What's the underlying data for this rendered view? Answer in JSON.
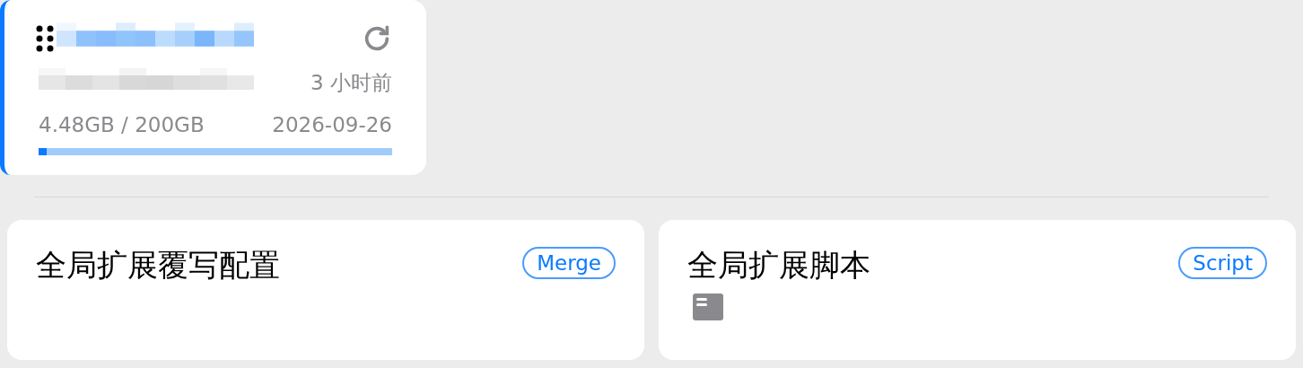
{
  "profile_card": {
    "selected": true,
    "updated": "3 小时前",
    "usage": "4.48GB / 200GB",
    "expires": "2026-09-26",
    "level": 0.0224
  },
  "extension_cards": [
    {
      "title": "全局扩展覆写配置",
      "tag": "Merge",
      "kind": "merge"
    },
    {
      "title": "全局扩展脚本",
      "tag": "Script",
      "kind": "script"
    }
  ]
}
